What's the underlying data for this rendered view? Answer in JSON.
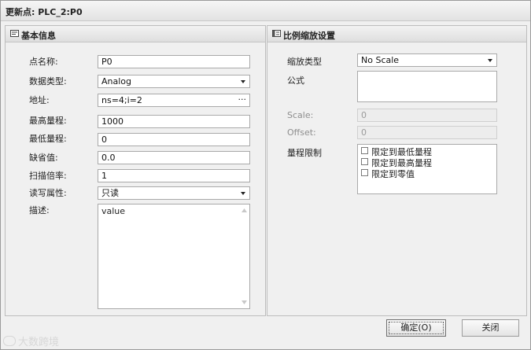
{
  "window": {
    "title": "更新点: PLC_2:P0"
  },
  "left_panel": {
    "title": "基本信息",
    "icon": "form-icon",
    "fields": {
      "name": {
        "label": "点名称:",
        "value": "P0"
      },
      "data_type": {
        "label": "数据类型:",
        "value": "Analog"
      },
      "address": {
        "label": "地址:",
        "value": "ns=4;i=2",
        "browse": "···"
      },
      "max_range": {
        "label": "最高量程:",
        "value": "1000"
      },
      "min_range": {
        "label": "最低量程:",
        "value": "0"
      },
      "default_value": {
        "label": "缺省值:",
        "value": "0.0"
      },
      "scan_rate": {
        "label": "扫描倍率:",
        "value": "1"
      },
      "rw_attr": {
        "label": "读写属性:",
        "value": "只读"
      },
      "description": {
        "label": "描述:",
        "value": "value"
      }
    }
  },
  "right_panel": {
    "title": "比例缩放设置",
    "icon": "list-icon",
    "fields": {
      "scale_type": {
        "label": "缩放类型",
        "value": "No Scale"
      },
      "formula": {
        "label": "公式",
        "value": ""
      },
      "scale": {
        "label": "Scale:",
        "value": "0"
      },
      "offset": {
        "label": "Offset:",
        "value": "0"
      },
      "range_limit": {
        "label": "量程限制",
        "options": [
          {
            "label": "限定到最低量程",
            "checked": false
          },
          {
            "label": "限定到最高量程",
            "checked": false
          },
          {
            "label": "限定到零值",
            "checked": false
          }
        ]
      }
    }
  },
  "buttons": {
    "ok": "确定(O)",
    "close": "关闭"
  },
  "watermark": "大数跨境"
}
